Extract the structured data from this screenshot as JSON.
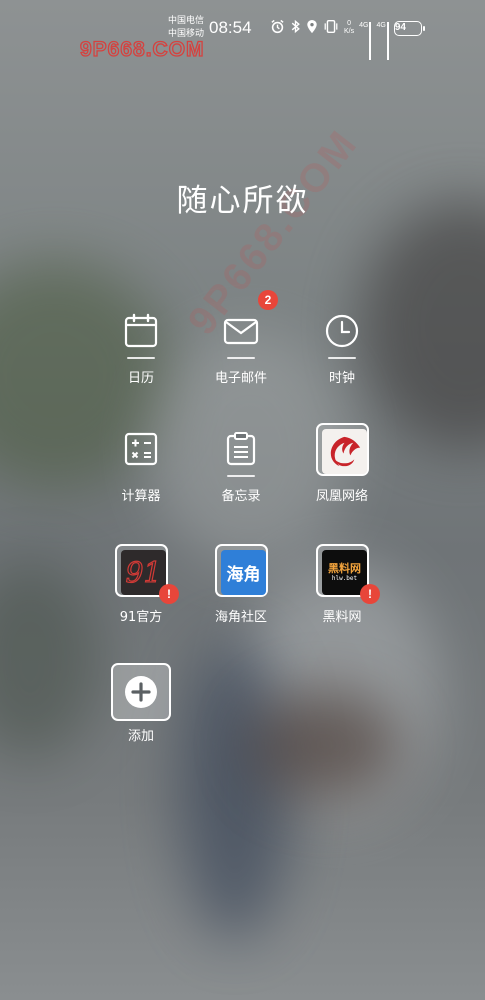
{
  "status_bar": {
    "carrier_1": "中国电信",
    "carrier_2": "中国移动",
    "time": "08:54",
    "speed_value": "0",
    "speed_unit": "K/s",
    "net_1": "4G",
    "net_2": "4G",
    "battery": "94"
  },
  "watermark": "9P668.COM",
  "folder": {
    "title": "随心所欲"
  },
  "apps": [
    {
      "label": "日历",
      "icon": "calendar-icon"
    },
    {
      "label": "电子邮件",
      "icon": "mail-icon",
      "badge": "2"
    },
    {
      "label": "时钟",
      "icon": "clock-icon"
    },
    {
      "label": "计算器",
      "icon": "calculator-icon"
    },
    {
      "label": "备忘录",
      "icon": "notes-icon"
    },
    {
      "label": "凤凰网络",
      "icon": "phoenix-icon"
    },
    {
      "label": "91官方",
      "icon": "app-91-icon",
      "logo_text": "91",
      "badge": "!"
    },
    {
      "label": "海角社区",
      "icon": "haijiao-icon",
      "logo_text": "海角",
      "badge": ""
    },
    {
      "label": "黑料网",
      "icon": "heiliao-icon",
      "logo_text": "黑料网",
      "logo_sub": "hlw.bet",
      "badge": "!"
    },
    {
      "label": "添加",
      "icon": "add-icon"
    }
  ],
  "colors": {
    "badge": "#e8463a",
    "haijiao_bg": "#2f7fd8",
    "phoenix_red": "#c8242a",
    "heiliao_orange": "#f0a23c"
  }
}
